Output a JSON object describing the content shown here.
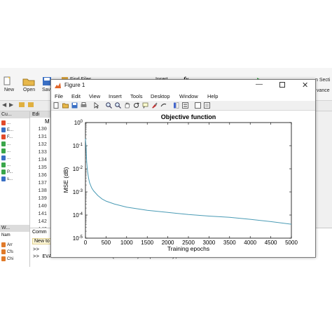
{
  "desktop": {
    "ribbon": {
      "new_label": "New",
      "open_label": "Open",
      "save_label": "Sav",
      "find_files_label": "Find Files",
      "insert_label": "Insert",
      "fx_label": "fx",
      "section_label": "n Secti",
      "advance_label": "vance"
    },
    "current_folder_title": "Cu...",
    "file_tree": [
      "...",
      "E...",
      "F...",
      "...",
      "...",
      "...",
      "...",
      "P...",
      "s..."
    ],
    "editor_tab_label": "Edi",
    "editor_first_token": "M",
    "line_numbers": [
      "130",
      "131",
      "132",
      "133",
      "134",
      "135",
      "136",
      "137",
      "138",
      "139",
      "140",
      "141",
      "142",
      "143",
      "144",
      "145"
    ],
    "workspace_title": "W...",
    "workspace_header": "Nam",
    "workspace_items": [
      "Arr",
      "Cfs",
      "Chi"
    ],
    "command_window_title": "Comm",
    "command_new_label": "New to",
    "command_line_1": ">>",
    "command_line_2": ">> EVAL=MLPClassification(DatFuse,OutputData);"
  },
  "figure": {
    "title": "Figure 1",
    "menu": [
      "File",
      "Edit",
      "View",
      "Insert",
      "Tools",
      "Desktop",
      "Window",
      "Help"
    ],
    "toolbar_icons": [
      "new-figure-icon",
      "open-icon",
      "save-icon",
      "print-icon",
      "pointer-icon",
      "zoom-in-icon",
      "zoom-out-icon",
      "pan-icon",
      "rotate-icon",
      "data-cursor-icon",
      "brush-icon",
      "link-icon",
      "colorbar-icon",
      "legend-icon",
      "hide-plot-tools-icon",
      "show-plot-tools-icon"
    ]
  },
  "chart_data": {
    "type": "line",
    "title": "Objective function",
    "xlabel": "Training epochs",
    "ylabel": "MSE (dB)",
    "yscale": "log",
    "xlim": [
      0,
      5000
    ],
    "ylim": [
      1e-05,
      1
    ],
    "xticks": [
      "0",
      "500",
      "1000",
      "1500",
      "2000",
      "2500",
      "3000",
      "3500",
      "4000",
      "4500",
      "5000"
    ],
    "yticks": [
      {
        "base": "10",
        "exp": "0"
      },
      {
        "base": "10",
        "exp": "-1"
      },
      {
        "base": "10",
        "exp": "-2"
      },
      {
        "base": "10",
        "exp": "-3"
      },
      {
        "base": "10",
        "exp": "-4"
      },
      {
        "base": "10",
        "exp": "-5"
      }
    ],
    "line_color": "#4a9bb5",
    "grid": false,
    "series": [
      {
        "x": [
          0,
          10,
          20,
          30,
          50,
          75,
          100,
          150,
          200,
          300,
          400,
          500,
          700,
          1000,
          1500,
          2000,
          2500,
          3000,
          3500,
          4000,
          4500,
          5000
        ],
        "y": [
          0.2,
          0.12,
          0.05,
          0.02,
          0.008,
          0.004,
          0.0025,
          0.0015,
          0.0011,
          0.0007,
          0.0005,
          0.0004,
          0.0003,
          0.00022,
          0.00016,
          0.00013,
          0.000105,
          9e-05,
          8e-05,
          6.5e-05,
          5.2e-05,
          4e-05
        ]
      }
    ]
  }
}
